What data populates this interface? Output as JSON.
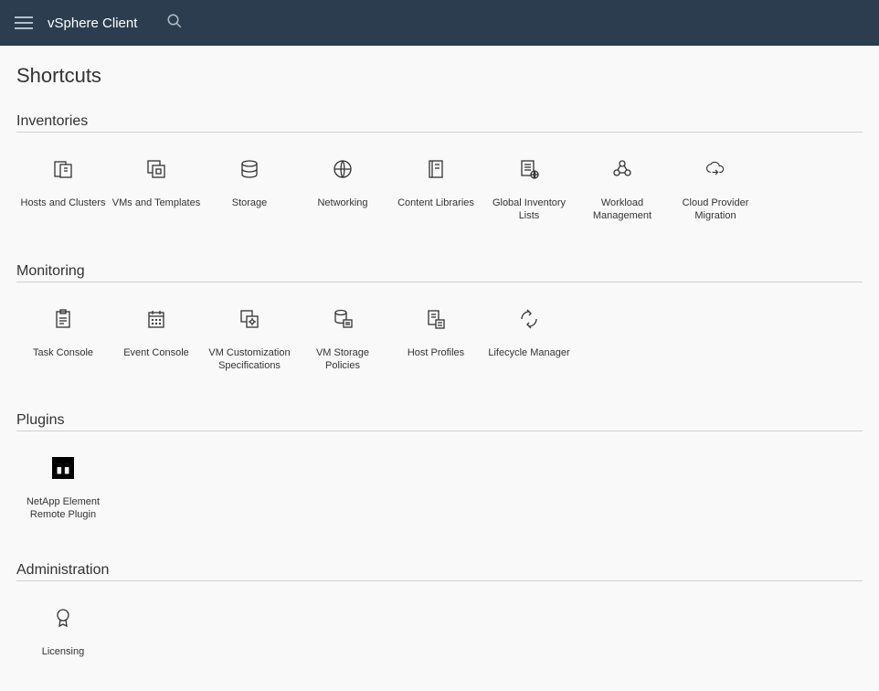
{
  "header": {
    "appTitle": "vSphere Client"
  },
  "page": {
    "title": "Shortcuts"
  },
  "sections": {
    "inventories": {
      "title": "Inventories",
      "items": [
        {
          "label": "Hosts and Clusters",
          "icon": "hosts-clusters-icon"
        },
        {
          "label": "VMs and Templates",
          "icon": "vms-templates-icon"
        },
        {
          "label": "Storage",
          "icon": "storage-icon"
        },
        {
          "label": "Networking",
          "icon": "networking-icon"
        },
        {
          "label": "Content Libraries",
          "icon": "content-libraries-icon"
        },
        {
          "label": "Global Inventory Lists",
          "icon": "global-inventory-icon"
        },
        {
          "label": "Workload Management",
          "icon": "workload-management-icon"
        },
        {
          "label": "Cloud Provider Migration",
          "icon": "cloud-migration-icon"
        }
      ]
    },
    "monitoring": {
      "title": "Monitoring",
      "items": [
        {
          "label": "Task Console",
          "icon": "task-console-icon"
        },
        {
          "label": "Event Console",
          "icon": "event-console-icon"
        },
        {
          "label": "VM Customization Specifications",
          "icon": "vm-customization-icon"
        },
        {
          "label": "VM Storage Policies",
          "icon": "vm-storage-policies-icon"
        },
        {
          "label": "Host Profiles",
          "icon": "host-profiles-icon"
        },
        {
          "label": "Lifecycle Manager",
          "icon": "lifecycle-manager-icon"
        }
      ]
    },
    "plugins": {
      "title": "Plugins",
      "items": [
        {
          "label": "NetApp Element Remote Plugin",
          "icon": "netapp-icon"
        }
      ]
    },
    "administration": {
      "title": "Administration",
      "items": [
        {
          "label": "Licensing",
          "icon": "licensing-icon"
        }
      ]
    }
  }
}
